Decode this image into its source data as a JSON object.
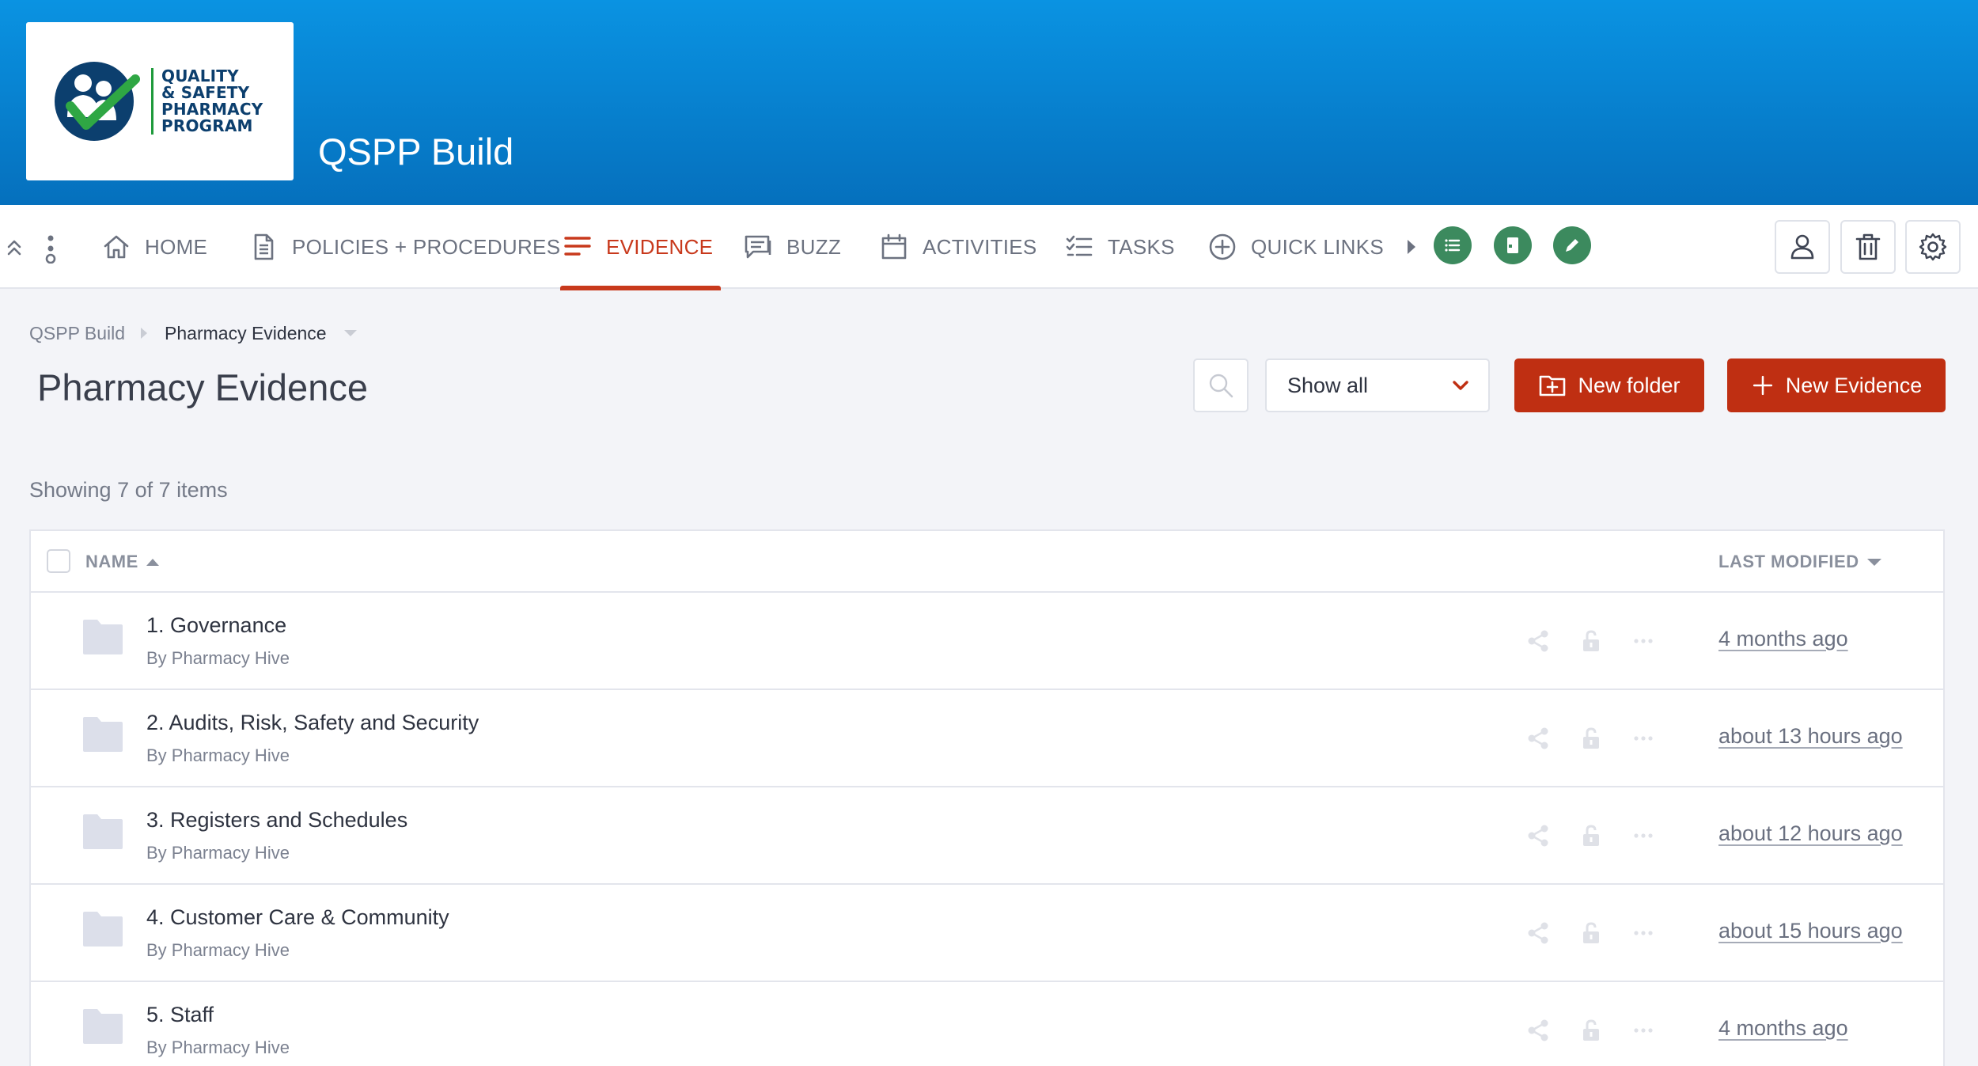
{
  "logo": {
    "lines": [
      "QUALITY",
      "& SAFETY",
      "PHARMACY",
      "PROGRAM"
    ]
  },
  "header": {
    "title": "QSPP Build"
  },
  "nav": {
    "items": [
      {
        "label": "HOME",
        "icon": "home-icon"
      },
      {
        "label": "POLICIES + PROCEDURES",
        "icon": "document-icon"
      },
      {
        "label": "EVIDENCE",
        "icon": "lines-icon",
        "active": true
      },
      {
        "label": "BUZZ",
        "icon": "chat-icon"
      },
      {
        "label": "ACTIVITIES",
        "icon": "calendar-icon"
      },
      {
        "label": "TASKS",
        "icon": "checklist-icon"
      },
      {
        "label": "QUICK LINKS",
        "icon": "plus-circle-icon"
      }
    ],
    "quick_buttons": [
      "list-icon",
      "book-icon",
      "pencil-icon"
    ],
    "right_buttons": [
      "user-icon",
      "trash-icon",
      "gear-icon"
    ],
    "accent": "#c8391c",
    "quick_color": "#3c8a5e"
  },
  "breadcrumb": {
    "root": "QSPP Build",
    "current": "Pharmacy Evidence"
  },
  "page": {
    "title": "Pharmacy Evidence",
    "showing": "Showing 7 of 7 items"
  },
  "toolbar": {
    "filter_value": "Show all",
    "new_folder_label": "New folder",
    "new_evidence_label": "New Evidence",
    "button_color": "#bf2f12"
  },
  "list": {
    "columns": {
      "name": "NAME",
      "modified": "LAST MODIFIED"
    },
    "rows": [
      {
        "title": "1. Governance",
        "by": "By Pharmacy Hive",
        "modified": "4 months ago"
      },
      {
        "title": "2. Audits, Risk, Safety and Security",
        "by": "By Pharmacy Hive",
        "modified": "about 13 hours ago"
      },
      {
        "title": "3. Registers and Schedules",
        "by": "By Pharmacy Hive",
        "modified": "about 12 hours ago"
      },
      {
        "title": "4. Customer Care & Community",
        "by": "By Pharmacy Hive",
        "modified": "about 15 hours ago"
      },
      {
        "title": "5. Staff",
        "by": "By Pharmacy Hive",
        "modified": "4 months ago"
      }
    ]
  }
}
